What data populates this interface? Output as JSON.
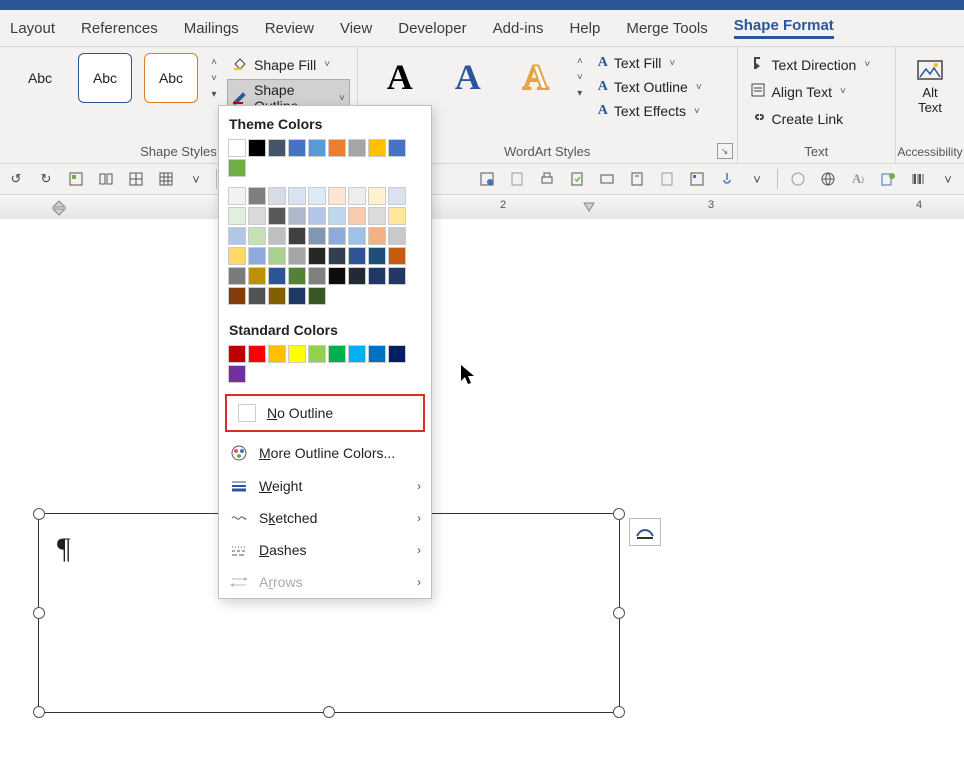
{
  "tabs": [
    "Layout",
    "References",
    "Mailings",
    "Review",
    "View",
    "Developer",
    "Add-ins",
    "Help",
    "Merge Tools",
    "Shape Format"
  ],
  "active_tab_index": 9,
  "ribbon": {
    "shape_styles": {
      "label": "Shape Styles",
      "thumbs_text": "Abc",
      "shape_fill": "Shape Fill",
      "shape_outline": "Shape Outline"
    },
    "wordart": {
      "label": "WordArt Styles",
      "letter": "A",
      "text_fill": "Text Fill",
      "text_outline": "Text Outline",
      "text_effects": "Text Effects"
    },
    "text_group": {
      "label": "Text",
      "text_direction": "Text Direction",
      "align_text": "Align Text",
      "create_link": "Create Link"
    },
    "accessibility": {
      "label": "Accessibility",
      "alt_text_top": "Alt",
      "alt_text_bottom": "Text"
    }
  },
  "popup": {
    "theme_title": "Theme Colors",
    "standard_title": "Standard Colors",
    "no_outline": "No Outline",
    "more_colors": "More Outline Colors...",
    "weight": "Weight",
    "sketched": "Sketched",
    "dashes": "Dashes",
    "arrows": "Arrows",
    "theme_row1": [
      "#ffffff",
      "#000000",
      "#44546a",
      "#4472c4",
      "#5b9bd5",
      "#ed7d31",
      "#a5a5a5",
      "#ffc000",
      "#4472c4",
      "#70ad47"
    ],
    "theme_shades": [
      [
        "#f2f2f2",
        "#7f7f7f",
        "#d6dce5",
        "#d9e2f3",
        "#deebf7",
        "#fbe5d6",
        "#ededed",
        "#fff2cc",
        "#d9e2f3",
        "#e2efda"
      ],
      [
        "#d9d9d9",
        "#595959",
        "#adb9ca",
        "#b4c6e7",
        "#bdd7ee",
        "#f7cbac",
        "#dbdbdb",
        "#ffe699",
        "#b4c6e7",
        "#c5e0b4"
      ],
      [
        "#bfbfbf",
        "#404040",
        "#8497b0",
        "#8eaadb",
        "#9cc3e6",
        "#f4b183",
        "#c9c9c9",
        "#ffd966",
        "#8eaadb",
        "#a9d18e"
      ],
      [
        "#a6a6a6",
        "#262626",
        "#333f50",
        "#2f5496",
        "#1f4e79",
        "#c55a11",
        "#7b7b7b",
        "#bf9000",
        "#2f5496",
        "#548235"
      ],
      [
        "#808080",
        "#0d0d0d",
        "#222a35",
        "#1f3864",
        "#1f3864",
        "#833c0c",
        "#525252",
        "#806000",
        "#1f3864",
        "#385723"
      ]
    ],
    "standard": [
      "#c00000",
      "#ff0000",
      "#ffc000",
      "#ffff00",
      "#92d050",
      "#00b050",
      "#00b0f0",
      "#0070c0",
      "#002060",
      "#7030a0"
    ]
  },
  "ruler_numbers": {
    "r2": "2",
    "r3": "3",
    "r4": "4"
  },
  "text_box": {
    "para_mark": "¶"
  }
}
